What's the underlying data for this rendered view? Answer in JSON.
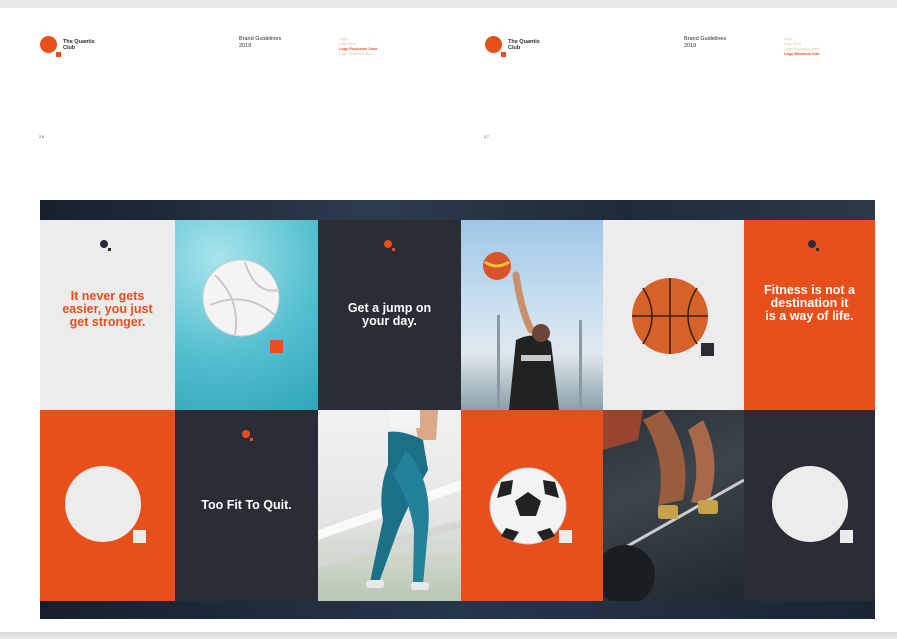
{
  "left_page": {
    "logo_text": "The Quantis Club",
    "meta_text": "Brand Guidelines 2019",
    "menu": [
      "Logo",
      "Logo Grid",
      "Logo Exclusion Zone",
      "Logo Minimum Size"
    ],
    "active_menu_index": 2,
    "page_number": "26"
  },
  "right_page": {
    "logo_text": "The Quantis Club",
    "meta_text": "Brand Guidelines 2019",
    "menu": [
      "Logo",
      "Logo Grid",
      "Logo Exclusion Zone",
      "Logo Minimum Size"
    ],
    "active_menu_index": 3,
    "page_number": "27"
  },
  "tiles": {
    "quote_1": "It never gets easier, you just get stronger.",
    "quote_2": "Get a jump on your day.",
    "quote_3": "Fitness is not a destination it is a way of life.",
    "quote_4": "Too Fit To Quit.",
    "photos": [
      "volleyball-photo",
      "basketball-player-photo",
      "basketball-photo",
      "runner-photo",
      "soccer-ball-photo",
      "weightlifter-photo"
    ]
  },
  "colors": {
    "brand_orange": "#e94f1b",
    "brand_dark": "#2b2d36",
    "brand_light": "#ececec"
  }
}
